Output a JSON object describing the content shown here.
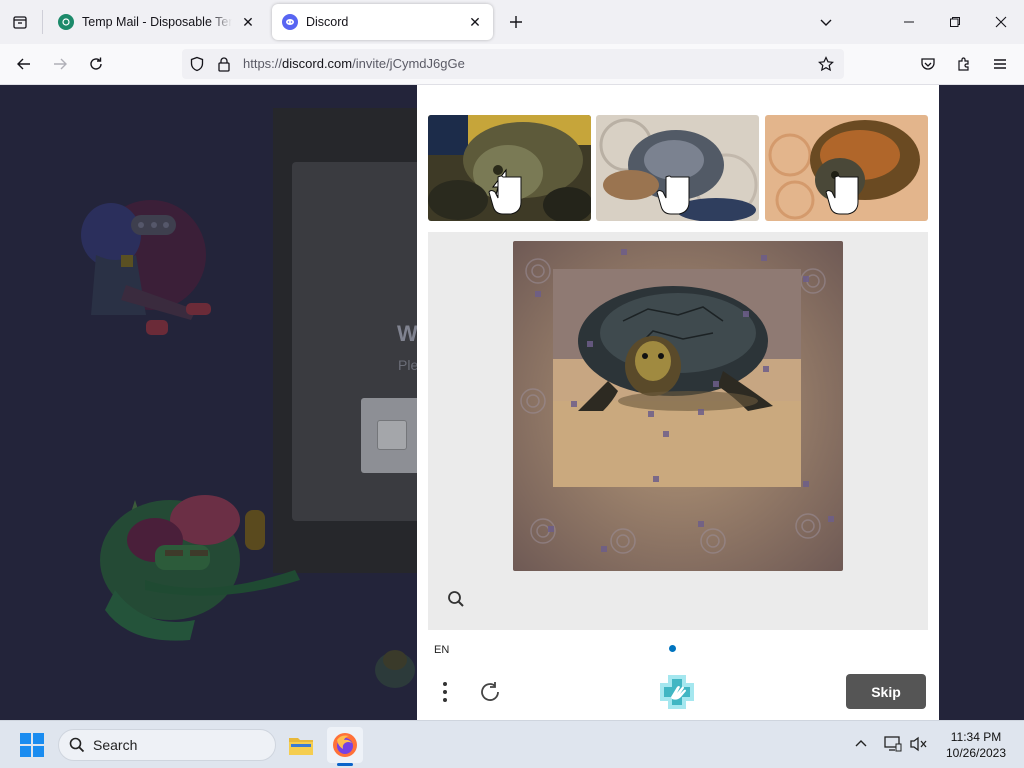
{
  "browser": {
    "tabs": [
      {
        "title": "Temp Mail - Disposable Temporary Email",
        "active": false,
        "favicon": "tempmail-favicon"
      },
      {
        "title": "Discord",
        "active": true,
        "favicon": "discord-favicon"
      }
    ],
    "url": {
      "prefix": "https://",
      "host": "discord.com",
      "path": "/invite/jCymdJ6gGe"
    }
  },
  "page": {
    "heading": "W",
    "subtext": "Ple"
  },
  "captcha": {
    "prompt_images": [
      "turtle-prompt-1",
      "turtle-prompt-2",
      "turtle-prompt-3"
    ],
    "challenge_image": "turtle-on-sand",
    "language": "EN",
    "skip_label": "Skip",
    "colors": {
      "skip_bg": "#555555",
      "dot": "#0074bf",
      "accent": "#00838f"
    }
  },
  "taskbar": {
    "search_label": "Search",
    "time": "11:34 PM",
    "date": "10/26/2023"
  }
}
